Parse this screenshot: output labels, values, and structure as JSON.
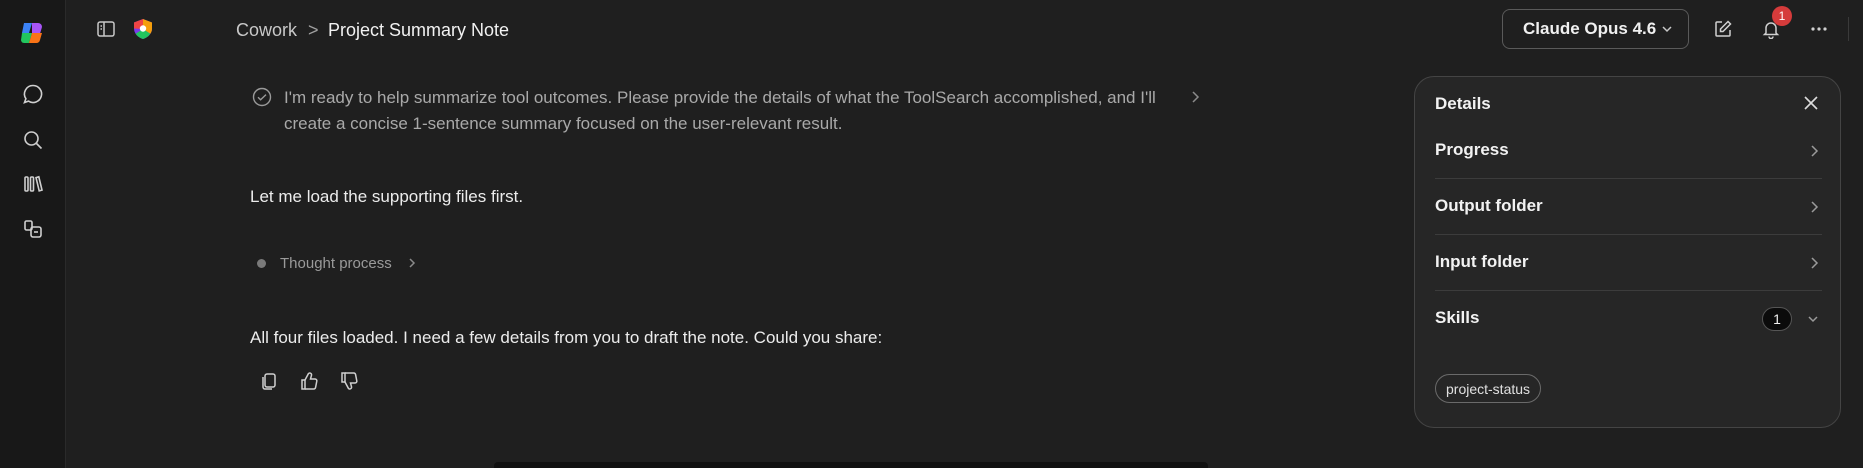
{
  "breadcrumb": {
    "root": "Cowork",
    "separator": ">",
    "current": "Project Summary Note"
  },
  "model": {
    "label": "Claude Opus 4.6"
  },
  "notifications": {
    "count": "1"
  },
  "conversation": {
    "tool_result": "I'm ready to help summarize tool outcomes. Please provide the details of what the ToolSearch accomplished, and I'll create a concise 1-sentence summary focused on the user-relevant result.",
    "message_1": "Let me load the supporting files first.",
    "thought_label": "Thought process",
    "message_2": "All four files loaded. I need a few details from you to draft the note. Could you share:"
  },
  "details_panel": {
    "title": "Details",
    "rows": [
      {
        "label": "Progress"
      },
      {
        "label": "Output folder"
      },
      {
        "label": "Input folder"
      },
      {
        "label": "Skills",
        "count": "1"
      }
    ],
    "skill_chip": "project-status"
  },
  "colors": {
    "accent_badge": "#d53b3b",
    "background": "#1f1f1f",
    "panel": "#262626"
  }
}
